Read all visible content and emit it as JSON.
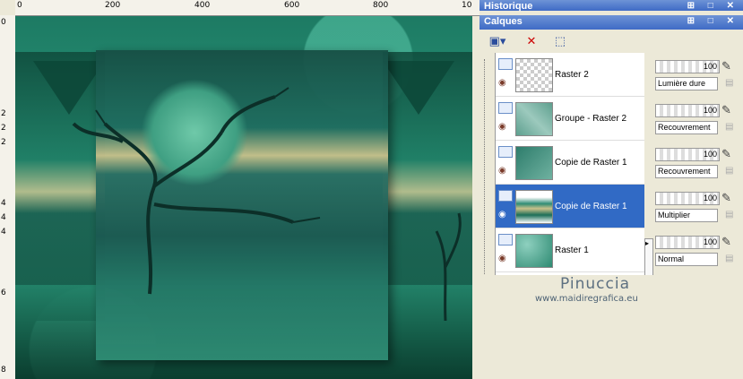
{
  "ruler": {
    "h_labels": [
      "0",
      "200",
      "400",
      "600",
      "800",
      "10"
    ],
    "v_labels": [
      "0",
      "2",
      "2",
      "2",
      "4",
      "4",
      "4",
      "6",
      "8"
    ]
  },
  "panels": {
    "history_title": "Historique",
    "layers_title": "Calques"
  },
  "layers": [
    {
      "name": "Raster 2",
      "opacity": "100",
      "blend": "Lumière dure",
      "selected": false
    },
    {
      "name": "Groupe - Raster 2",
      "opacity": "100",
      "blend": "Recouvrement",
      "selected": false
    },
    {
      "name": "Copie de Raster 1",
      "opacity": "100",
      "blend": "Recouvrement",
      "selected": false
    },
    {
      "name": "Copie de Raster 1",
      "opacity": "100",
      "blend": "Multiplier",
      "selected": true
    },
    {
      "name": "Raster 1",
      "opacity": "100",
      "blend": "Normal",
      "selected": false
    }
  ],
  "signature": {
    "name": "Pinuccia",
    "url": "www.maidiregrafica.eu"
  },
  "colors": {
    "title_bar": "#3f6bc6",
    "selection": "#316ac5",
    "canvas_main": "#1f8a6e"
  },
  "icons": [
    "new-layer-icon",
    "delete-layer-icon",
    "mask-icon",
    "eye-icon",
    "visibility-icon",
    "brush-icon",
    "lock-icon"
  ]
}
